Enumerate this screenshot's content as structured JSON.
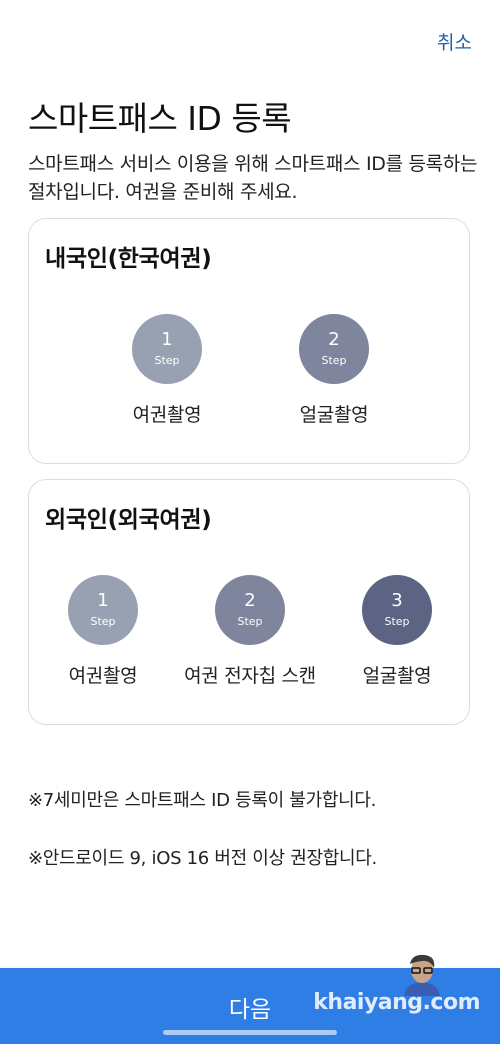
{
  "header": {
    "cancel_label": "취소"
  },
  "title": "스마트패스 ID 등록",
  "description": "스마트패스 서비스 이용을 위해 스마트패스 ID를 등록하는 절차입니다. 여권을 준비해 주세요.",
  "korean": {
    "title": "내국인(한국여권)",
    "steps": [
      {
        "number": "1",
        "word": "Step",
        "label": "여권촬영"
      },
      {
        "number": "2",
        "word": "Step",
        "label": "얼굴촬영"
      }
    ]
  },
  "foreign": {
    "title": "외국인(외국여권)",
    "steps": [
      {
        "number": "1",
        "word": "Step",
        "label": "여권촬영"
      },
      {
        "number": "2",
        "word": "Step",
        "label": "여권 전자칩 스캔"
      },
      {
        "number": "3",
        "word": "Step",
        "label": "얼굴촬영"
      }
    ]
  },
  "notes": [
    "※7세미만은 스마트패스 ID 등록이 불가합니다.",
    "※안드로이드 9, iOS 16 버전 이상 권장합니다."
  ],
  "next_button": {
    "label": "다음"
  },
  "watermark": "khaiyang.com",
  "colors": {
    "accent": "#2f7ee6",
    "link": "#1f5fb0",
    "step1": "#98a1b2",
    "step2": "#7e859c",
    "step3": "#5d6483",
    "card_border": "#d9dde3"
  }
}
